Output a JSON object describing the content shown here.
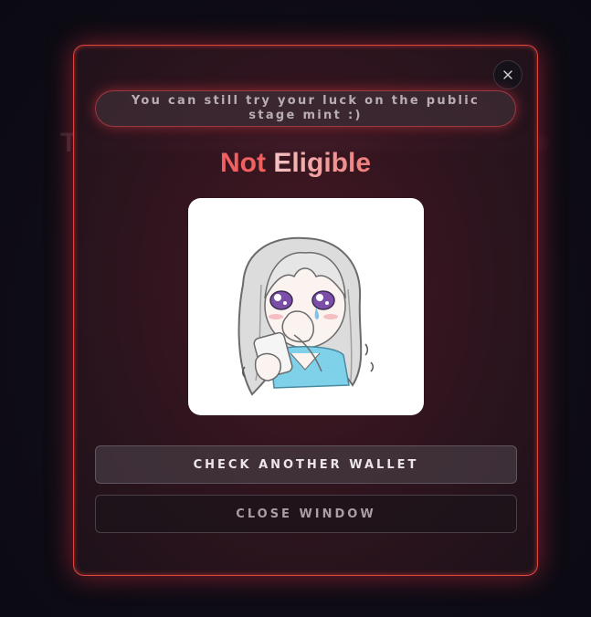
{
  "background": {
    "ghost_text": "T"
  },
  "modal": {
    "notice": "You can still try your luck on the public stage mint :)",
    "title_part1": "Not",
    "title_part2": "Eligible",
    "image_icon": "crying-chibi-girl-sticker",
    "buttons": {
      "check_another": "CHECK ANOTHER WALLET",
      "close_window": "CLOSE WINDOW"
    },
    "close_icon": "close-icon"
  },
  "colors": {
    "accent": "#e0443f",
    "title_red": "#f0605f",
    "background": "#0f0c16"
  }
}
